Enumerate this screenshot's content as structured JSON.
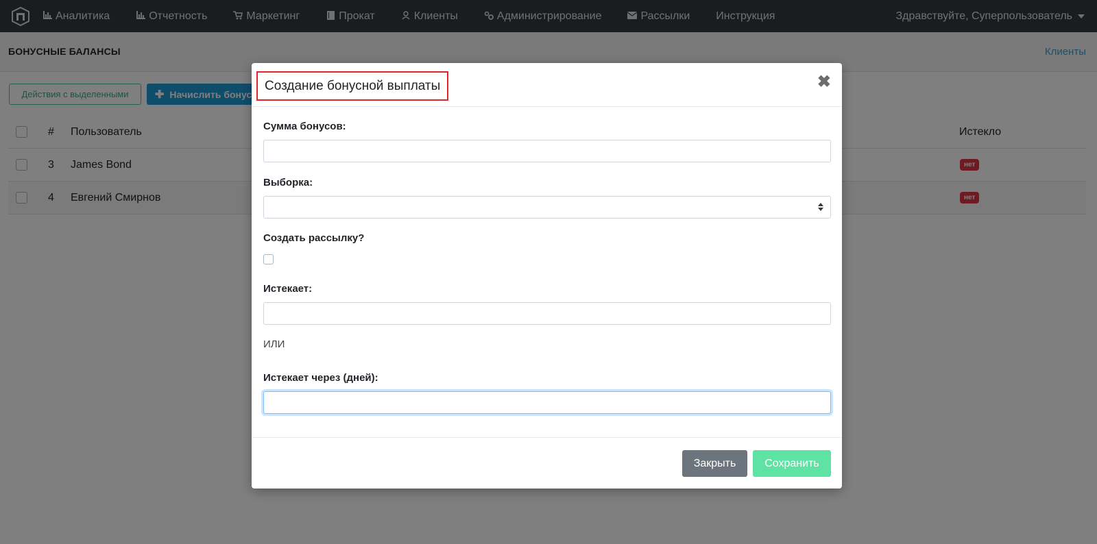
{
  "navbar": {
    "items": [
      {
        "label": "Аналитика",
        "icon": "bar-chart-icon"
      },
      {
        "label": "Отчетность",
        "icon": "bar-chart-icon"
      },
      {
        "label": "Маркетинг",
        "icon": "cart-icon"
      },
      {
        "label": "Прокат",
        "icon": "book-icon"
      },
      {
        "label": "Клиенты",
        "icon": "user-icon"
      },
      {
        "label": "Администрирование",
        "icon": "gears-icon"
      },
      {
        "label": "Рассылки",
        "icon": "envelope-icon"
      },
      {
        "label": "Инструкция",
        "icon": ""
      }
    ],
    "user_greeting": "Здравствуйте, Суперпользователь"
  },
  "header": {
    "title": "БОНУСНЫЕ БАЛАНСЫ",
    "breadcrumb": "Клиенты"
  },
  "toolbar": {
    "actions_label": "Действия с выделенными",
    "add_label": "Начислить бонусы"
  },
  "table": {
    "columns": {
      "num": "#",
      "user": "Пользователь",
      "expired": "Истекло"
    },
    "rows": [
      {
        "num": "3",
        "user": "James Bond",
        "expired": "нет"
      },
      {
        "num": "4",
        "user": "Евгений Смирнов",
        "expired": "нет"
      }
    ]
  },
  "modal": {
    "title": "Создание бонусной выплаты",
    "close_symbol": "✖",
    "amount_label": "Сумма бонусов:",
    "amount_value": "",
    "selection_label": "Выборка:",
    "selection_value": "",
    "create_mailing_label": "Создать рассылку?",
    "expires_label": "Истекает:",
    "expires_value": "",
    "or_text": "ИЛИ",
    "expires_in_days_label": "Истекает через (дней):",
    "expires_in_days_value": "",
    "close_button": "Закрыть",
    "save_button": "Сохранить"
  },
  "colors": {
    "navbar": "#343a40",
    "primary": "#1e9ad6",
    "danger": "#dc3545",
    "save": "#5ee3a4",
    "secondary": "#6c757d"
  }
}
